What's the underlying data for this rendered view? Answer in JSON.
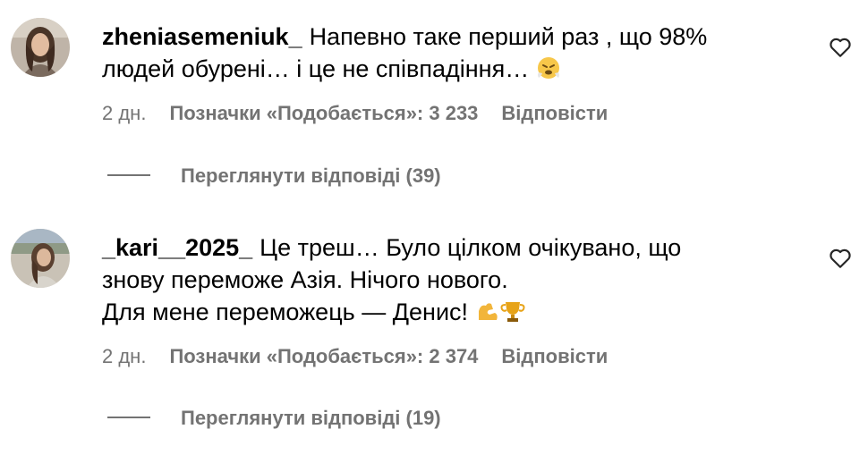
{
  "comments": [
    {
      "username": "zheniasemeniuk_",
      "lines": [
        "Напевно таке перший раз , що 98%",
        "людей обурені… і це не співпадіння…"
      ],
      "emoji": "😤",
      "time": "2 дн.",
      "likes": "Позначки «Подобається»: 3 233",
      "reply_label": "Відповісти",
      "view_replies": "Переглянути відповіді (39)"
    },
    {
      "username": "_kari__2025_",
      "lines": [
        "Це треш… Було цілком очікувано, що",
        "знову переможе Азія. Нічого нового.",
        "Для мене переможець — Денис!"
      ],
      "emoji": "💪🏆",
      "time": "2 дн.",
      "likes": "Позначки «Подобається»: 2 374",
      "reply_label": "Відповісти",
      "view_replies": "Переглянути відповіді (19)"
    }
  ],
  "icons": {
    "like": "heart-outline-icon"
  },
  "colors": {
    "text": "#000000",
    "secondary": "#737373"
  }
}
